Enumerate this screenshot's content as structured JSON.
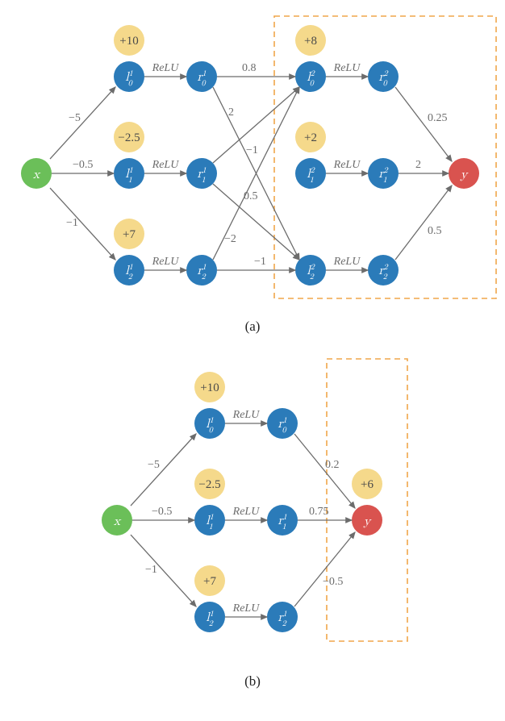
{
  "chart_data": [
    {
      "type": "diagram",
      "id": "a",
      "caption": "(a)",
      "title": "Two-layer ReLU network",
      "input": {
        "name": "x",
        "color": "green"
      },
      "output": {
        "name": "y",
        "color": "red"
      },
      "layers": [
        {
          "linear": [
            "l^1_0",
            "l^1_1",
            "l^1_2"
          ],
          "relu": [
            "r^1_0",
            "r^1_1",
            "r^1_2"
          ],
          "biases": [
            10,
            -2.5,
            7
          ]
        },
        {
          "linear": [
            "l^2_0",
            "l^2_1",
            "l^2_2"
          ],
          "relu": [
            "r^2_0",
            "r^2_1",
            "r^2_2"
          ],
          "biases": [
            8,
            2,
            null
          ]
        }
      ],
      "edges_x_to_l1": [
        {
          "to": 0,
          "w": -5
        },
        {
          "to": 1,
          "w": -0.5
        },
        {
          "to": 2,
          "w": -1
        }
      ],
      "edges_r1_to_l2": [
        {
          "from": 0,
          "to": 0,
          "w": 0.8
        },
        {
          "from": 0,
          "to": 2,
          "w": 2
        },
        {
          "from": 1,
          "to": 0,
          "w": -1
        },
        {
          "from": 1,
          "to": 2,
          "w": 0.5
        },
        {
          "from": 2,
          "to": 0,
          "w": -2
        },
        {
          "from": 2,
          "to": 2,
          "w": -1
        }
      ],
      "edges_r2_to_y": [
        {
          "from": 0,
          "w": 0.25
        },
        {
          "from": 1,
          "w": 2
        },
        {
          "from": 2,
          "w": 0.5
        }
      ],
      "relu_label": "ReLU",
      "highlight_box": "layer 2 through output"
    },
    {
      "type": "diagram",
      "id": "b",
      "caption": "(b)",
      "title": "Pruned / one-layer ReLU network",
      "input": {
        "name": "x",
        "color": "green"
      },
      "output": {
        "name": "y",
        "color": "red",
        "bias": 6
      },
      "layers": [
        {
          "linear": [
            "l^1_0",
            "l^1_1",
            "l^1_2"
          ],
          "relu": [
            "r^1_0",
            "r^1_1",
            "r^1_2"
          ],
          "biases": [
            10,
            -2.5,
            7
          ]
        }
      ],
      "edges_x_to_l1": [
        {
          "to": 0,
          "w": -5
        },
        {
          "to": 1,
          "w": -0.5
        },
        {
          "to": 2,
          "w": -1
        }
      ],
      "edges_r1_to_y": [
        {
          "from": 0,
          "w": 0.2
        },
        {
          "from": 1,
          "w": 0.75
        },
        {
          "from": 2,
          "w": -0.5
        }
      ],
      "relu_label": "ReLU",
      "highlight_box": "output"
    }
  ],
  "labels": {
    "relu": "ReLU",
    "caption_a": "(a)",
    "caption_b": "(b)",
    "x": "x",
    "y": "y",
    "bias_a0": "+10",
    "bias_a1": "−2.5",
    "bias_a2": "+7",
    "bias_a3": "+8",
    "bias_a4": "+2",
    "bias_b0": "+10",
    "bias_b1": "−2.5",
    "bias_b2": "+7",
    "bias_by": "+6",
    "w_x0": "−5",
    "w_x1": "−0.5",
    "w_x2": "−1",
    "w_r00": "0.8",
    "w_r02": "2",
    "w_r10": "−1",
    "w_r12": "0.5",
    "w_r20": "−2",
    "w_r22": "−1",
    "w_y0": "0.25",
    "w_y1": "2",
    "w_y2": "0.5",
    "wb_y0": "0.2",
    "wb_y1": "0.75",
    "wb_y2": "−0.5"
  }
}
